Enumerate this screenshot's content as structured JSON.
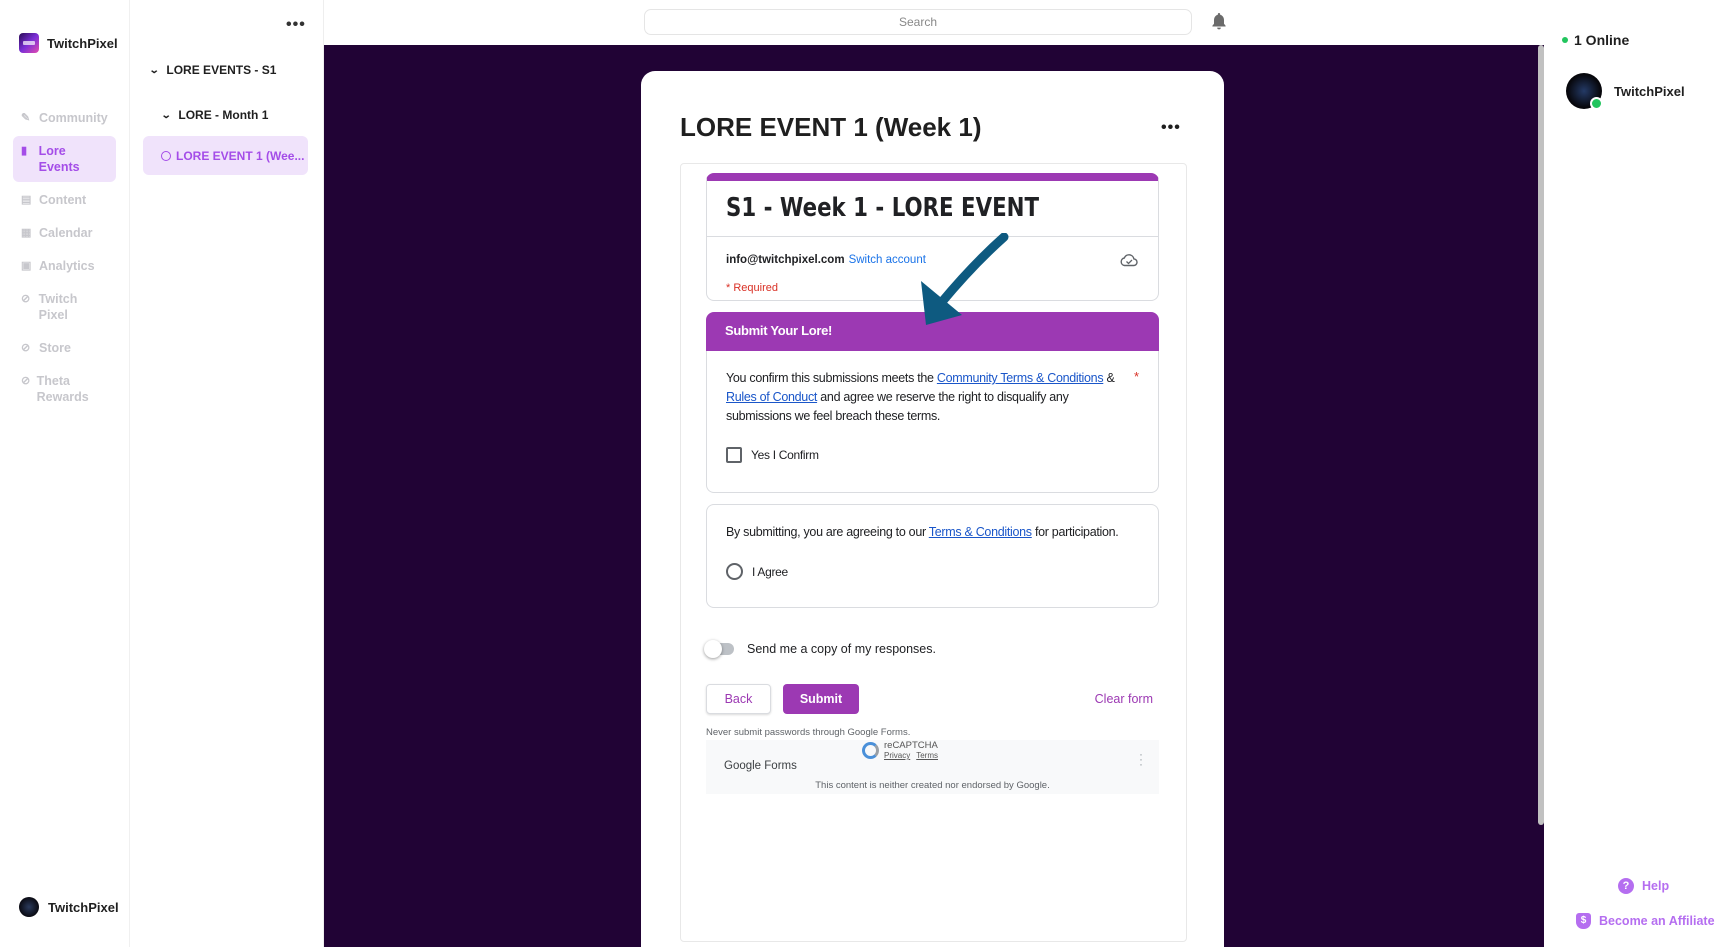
{
  "brand": {
    "name": "TwitchPixel"
  },
  "nav": {
    "items": [
      {
        "label": "Community",
        "icon": "pen-icon"
      },
      {
        "label": "Lore Events",
        "icon": "book-icon"
      },
      {
        "label": "Content",
        "icon": "document-icon"
      },
      {
        "label": "Calendar",
        "icon": "calendar-icon"
      },
      {
        "label": "Analytics",
        "icon": "chart-icon"
      },
      {
        "label": "Twitch Pixel",
        "icon": "link-icon"
      },
      {
        "label": "Store",
        "icon": "link-icon"
      },
      {
        "label": "Theta Rewards",
        "icon": "link-icon"
      }
    ],
    "active": "Lore Events",
    "bottom_user": "TwitchPixel"
  },
  "tree": {
    "more": "•••",
    "season": "LORE EVENTS - S1",
    "month": "LORE - Month 1",
    "event": "LORE EVENT 1 (Wee..."
  },
  "topbar": {
    "search_placeholder": "Search"
  },
  "card": {
    "title": "LORE EVENT 1 (Week 1)",
    "more": "•••"
  },
  "form": {
    "title": "S1 - Week 1 - LORE EVENT",
    "account_email": "info@twitchpixel.com",
    "switch_account": "Switch account",
    "required": "* Required",
    "section_title": "Submit Your Lore!",
    "q1": {
      "text_pre": "You confirm this submissions meets the ",
      "link1": "Community Terms & Conditions",
      "text_mid": " & ",
      "link2": "Rules of Conduct",
      "text_post": " and agree we reserve the right to disqualify any submissions we feel breach these terms.",
      "required_star": "*",
      "option": "Yes I Confirm"
    },
    "q2": {
      "text_pre": "By submitting, you are agreeing to our ",
      "link": "Terms & Conditions",
      "text_post": " for participation.",
      "option": "I Agree"
    },
    "copy_label": "Send me a copy of my responses.",
    "back": "Back",
    "submit": "Submit",
    "clear": "Clear form",
    "never": "Never submit passwords through Google Forms.",
    "google_forms": "Google Forms",
    "recaptcha": "reCAPTCHA",
    "privacy": "Privacy",
    "terms": "Terms",
    "disclaimer": "This content is neither created nor endorsed by Google."
  },
  "right": {
    "online": "1 Online",
    "member": "TwitchPixel",
    "help": "Help",
    "affiliate": "Become an Affiliate"
  },
  "colors": {
    "accent": "#9c39b3",
    "nav_active": "#a44de8",
    "main_bg": "#210335",
    "arrow": "#0e5a80"
  }
}
